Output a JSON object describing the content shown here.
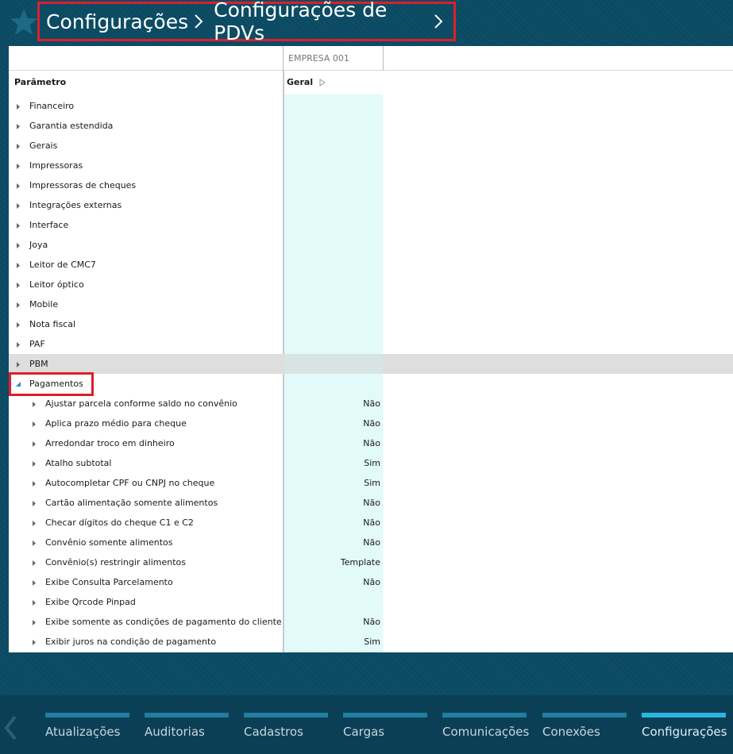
{
  "header": {
    "crumbs": [
      "Configurações",
      "Configurações de PDVs"
    ]
  },
  "grid": {
    "company_column": "EMPRESA 001",
    "param_header": "Parâmetro",
    "group_header": "Geral",
    "top_rows": [
      {
        "label": "Financeiro"
      },
      {
        "label": "Garantia estendida"
      },
      {
        "label": "Gerais"
      },
      {
        "label": "Impressoras"
      },
      {
        "label": "Impressoras de cheques"
      },
      {
        "label": "Integrações externas"
      },
      {
        "label": "Interface"
      },
      {
        "label": "Joya"
      },
      {
        "label": "Leitor de CMC7"
      },
      {
        "label": "Leitor óptico"
      },
      {
        "label": "Mobile"
      },
      {
        "label": "Nota fiscal"
      },
      {
        "label": "PAF"
      },
      {
        "label": "PBM"
      }
    ],
    "expanded_group": "Pagamentos",
    "sub_rows": [
      {
        "label": "Ajustar parcela conforme saldo no convênio",
        "value": "Não"
      },
      {
        "label": "Aplica prazo médio para cheque",
        "value": "Não"
      },
      {
        "label": "Arredondar troco em dinheiro",
        "value": "Não"
      },
      {
        "label": "Atalho subtotal",
        "value": "Sim"
      },
      {
        "label": "Autocompletar CPF ou CNPJ no cheque",
        "value": "Sim"
      },
      {
        "label": "Cartão alimentação somente alimentos",
        "value": "Não"
      },
      {
        "label": "Checar dígitos do cheque C1 e C2",
        "value": "Não"
      },
      {
        "label": "Convênio somente alimentos",
        "value": "Não"
      },
      {
        "label": "Convênio(s) restringir alimentos",
        "value": "Template"
      },
      {
        "label": "Exibe Consulta Parcelamento",
        "value": "Não"
      },
      {
        "label": "Exibe Qrcode Pinpad",
        "value": ""
      },
      {
        "label": "Exibe somente as condições de pagamento do cliente",
        "value": "Não"
      },
      {
        "label": "Exibir juros na condição de pagamento",
        "value": "Sim"
      }
    ]
  },
  "bottom_nav": {
    "items": [
      "Atualizações",
      "Auditorias",
      "Cadastros",
      "Cargas",
      "Comunicações",
      "Conexões",
      "Configurações"
    ],
    "active": "Configurações"
  },
  "colors": {
    "background": "#0a4a62",
    "highlight_border": "#e01e2a",
    "value_column": "#e2fafa",
    "nav_active": "#29b5e0"
  }
}
